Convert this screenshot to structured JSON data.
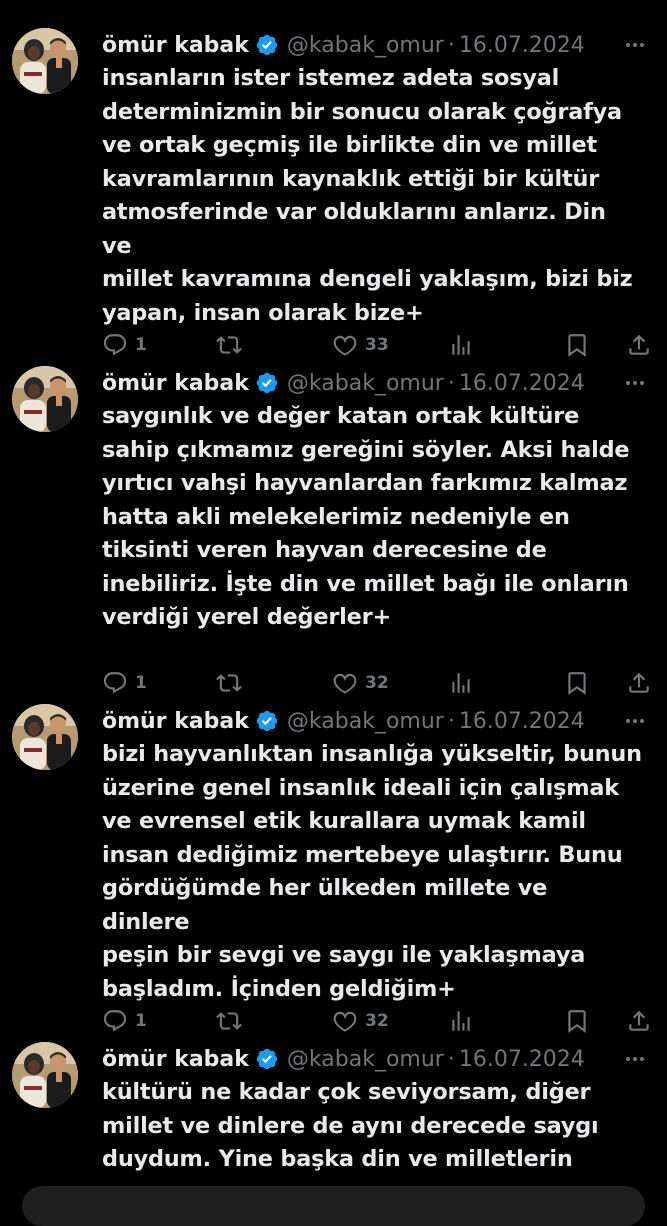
{
  "colors": {
    "background": "#000000",
    "text": "#e7e9ea",
    "muted": "#71767b",
    "verified": "#1d9bf0"
  },
  "icons": {
    "verified": "verified-badge-icon",
    "more": "more-horizontal-icon",
    "reply": "reply-icon",
    "retweet": "retweet-icon",
    "like": "heart-icon",
    "views": "views-icon",
    "bookmark": "bookmark-icon",
    "share": "share-icon"
  },
  "tweets": [
    {
      "name": "ömür kabak",
      "handle": "@kabak_omur",
      "separator": "·",
      "date": "16.07.2024",
      "text": "insanların ister istemez adeta sosyal\ndeterminizmin bir sonucu olarak çoğrafya\nve ortak geçmiş ile birlikte din ve millet\nkavramlarının kaynaklık ettiği bir kültür\natmosferinde var olduklarını anlarız. Din ve\nmillet kavramına dengeli yaklaşım, bizi biz\nyapan, insan olarak bize+",
      "replies": "1",
      "likes": "33"
    },
    {
      "name": "ömür kabak",
      "handle": "@kabak_omur",
      "separator": "·",
      "date": "16.07.2024",
      "text": "saygınlık ve değer katan ortak kültüre\nsahip çıkmamız gereğini söyler. Aksi halde\nyırtıcı vahşi hayvanlardan farkımız kalmaz\nhatta akli melekelerimiz nedeniyle en\ntiksinti veren hayvan derecesine de\ninebiliriz. İşte din ve millet bağı ile onların\nverdiği yerel değerler+",
      "replies": "1",
      "likes": "32"
    },
    {
      "name": "ömür kabak",
      "handle": "@kabak_omur",
      "separator": "·",
      "date": "16.07.2024",
      "text": "bizi hayvanlıktan insanlığa yükseltir, bunun\nüzerine genel insanlık ideali için çalışmak\nve evrensel etik kurallara uymak kamil\ninsan dediğimiz mertebeye ulaştırır. Bunu\ngördüğümde her ülkeden millete ve dinlere\npeşin bir sevgi ve saygı ile yaklaşmaya\nbaşladım. İçinden geldiğim+",
      "replies": "1",
      "likes": "32"
    },
    {
      "name": "ömür kabak",
      "handle": "@kabak_omur",
      "separator": "·",
      "date": "16.07.2024",
      "text": "kültürü ne kadar çok seviyorsam, diğer\nmillet ve dinlere de aynı derecede saygı\nduydum. Yine başka din ve milletlerin",
      "replies": "",
      "likes": ""
    }
  ]
}
